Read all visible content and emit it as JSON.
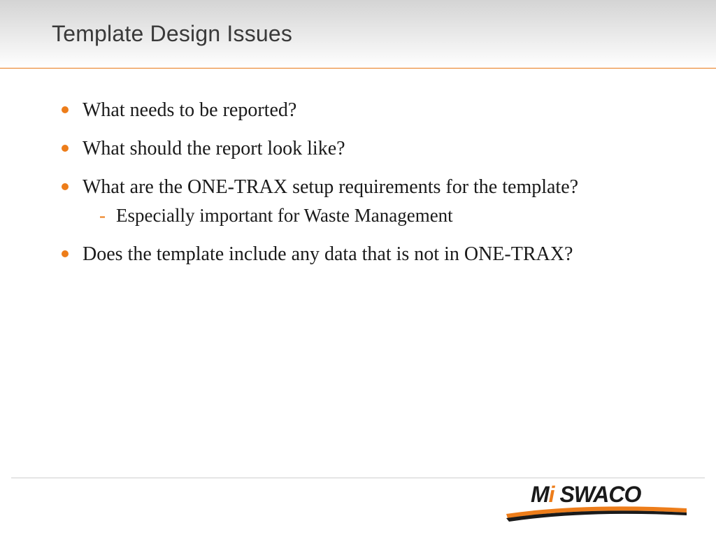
{
  "header": {
    "title": "Template Design Issues"
  },
  "bullets": [
    {
      "text": "What needs to be reported?",
      "sub": []
    },
    {
      "text": "What should the report look like?",
      "sub": []
    },
    {
      "text": "What are the ONE-TRAX setup requirements for the template?",
      "sub": [
        "Especially important for Waste Management"
      ]
    },
    {
      "text": "Does the template include any data that is not in ONE-TRAX?",
      "sub": []
    }
  ],
  "logo": {
    "part1": "M",
    "accent": "i",
    "part2": " SWACO"
  },
  "colors": {
    "accent": "#ed7d1a"
  }
}
